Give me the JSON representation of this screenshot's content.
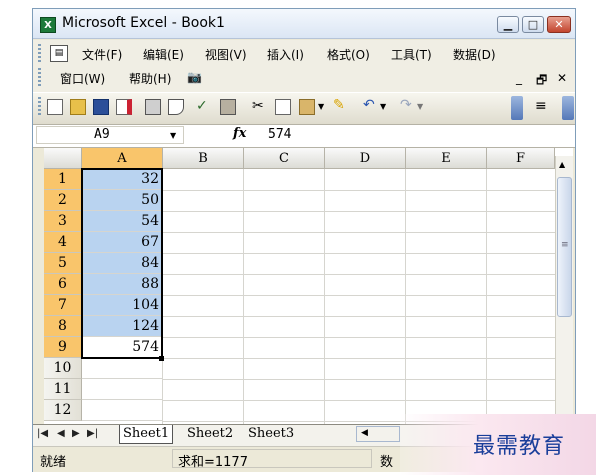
{
  "window": {
    "title": "Microsoft Excel - Book1",
    "app_icon": "excel-icon"
  },
  "menu": {
    "row1": [
      "文件(F)",
      "编辑(E)",
      "视图(V)",
      "插入(I)",
      "格式(O)",
      "工具(T)",
      "数据(D)"
    ],
    "row2": [
      "窗口(W)",
      "帮助(H)"
    ]
  },
  "formula_bar": {
    "name_box": "A9",
    "fx": "fx",
    "value": "574"
  },
  "columns": [
    "A",
    "B",
    "C",
    "D",
    "E",
    "F"
  ],
  "rows": [
    "1",
    "2",
    "3",
    "4",
    "5",
    "6",
    "7",
    "8",
    "9",
    "10",
    "11",
    "12"
  ],
  "column_a_values": [
    "32",
    "50",
    "54",
    "67",
    "84",
    "88",
    "104",
    "124",
    "574",
    "",
    "",
    ""
  ],
  "sheet_tabs": [
    "Sheet1",
    "Sheet2",
    "Sheet3"
  ],
  "status": {
    "ready": "就绪",
    "sum": "求和=1177",
    "num": "数"
  },
  "watermark": "最需教育",
  "colors": {
    "selection": "#b9d3f0",
    "header_selected": "#f9c56b"
  }
}
